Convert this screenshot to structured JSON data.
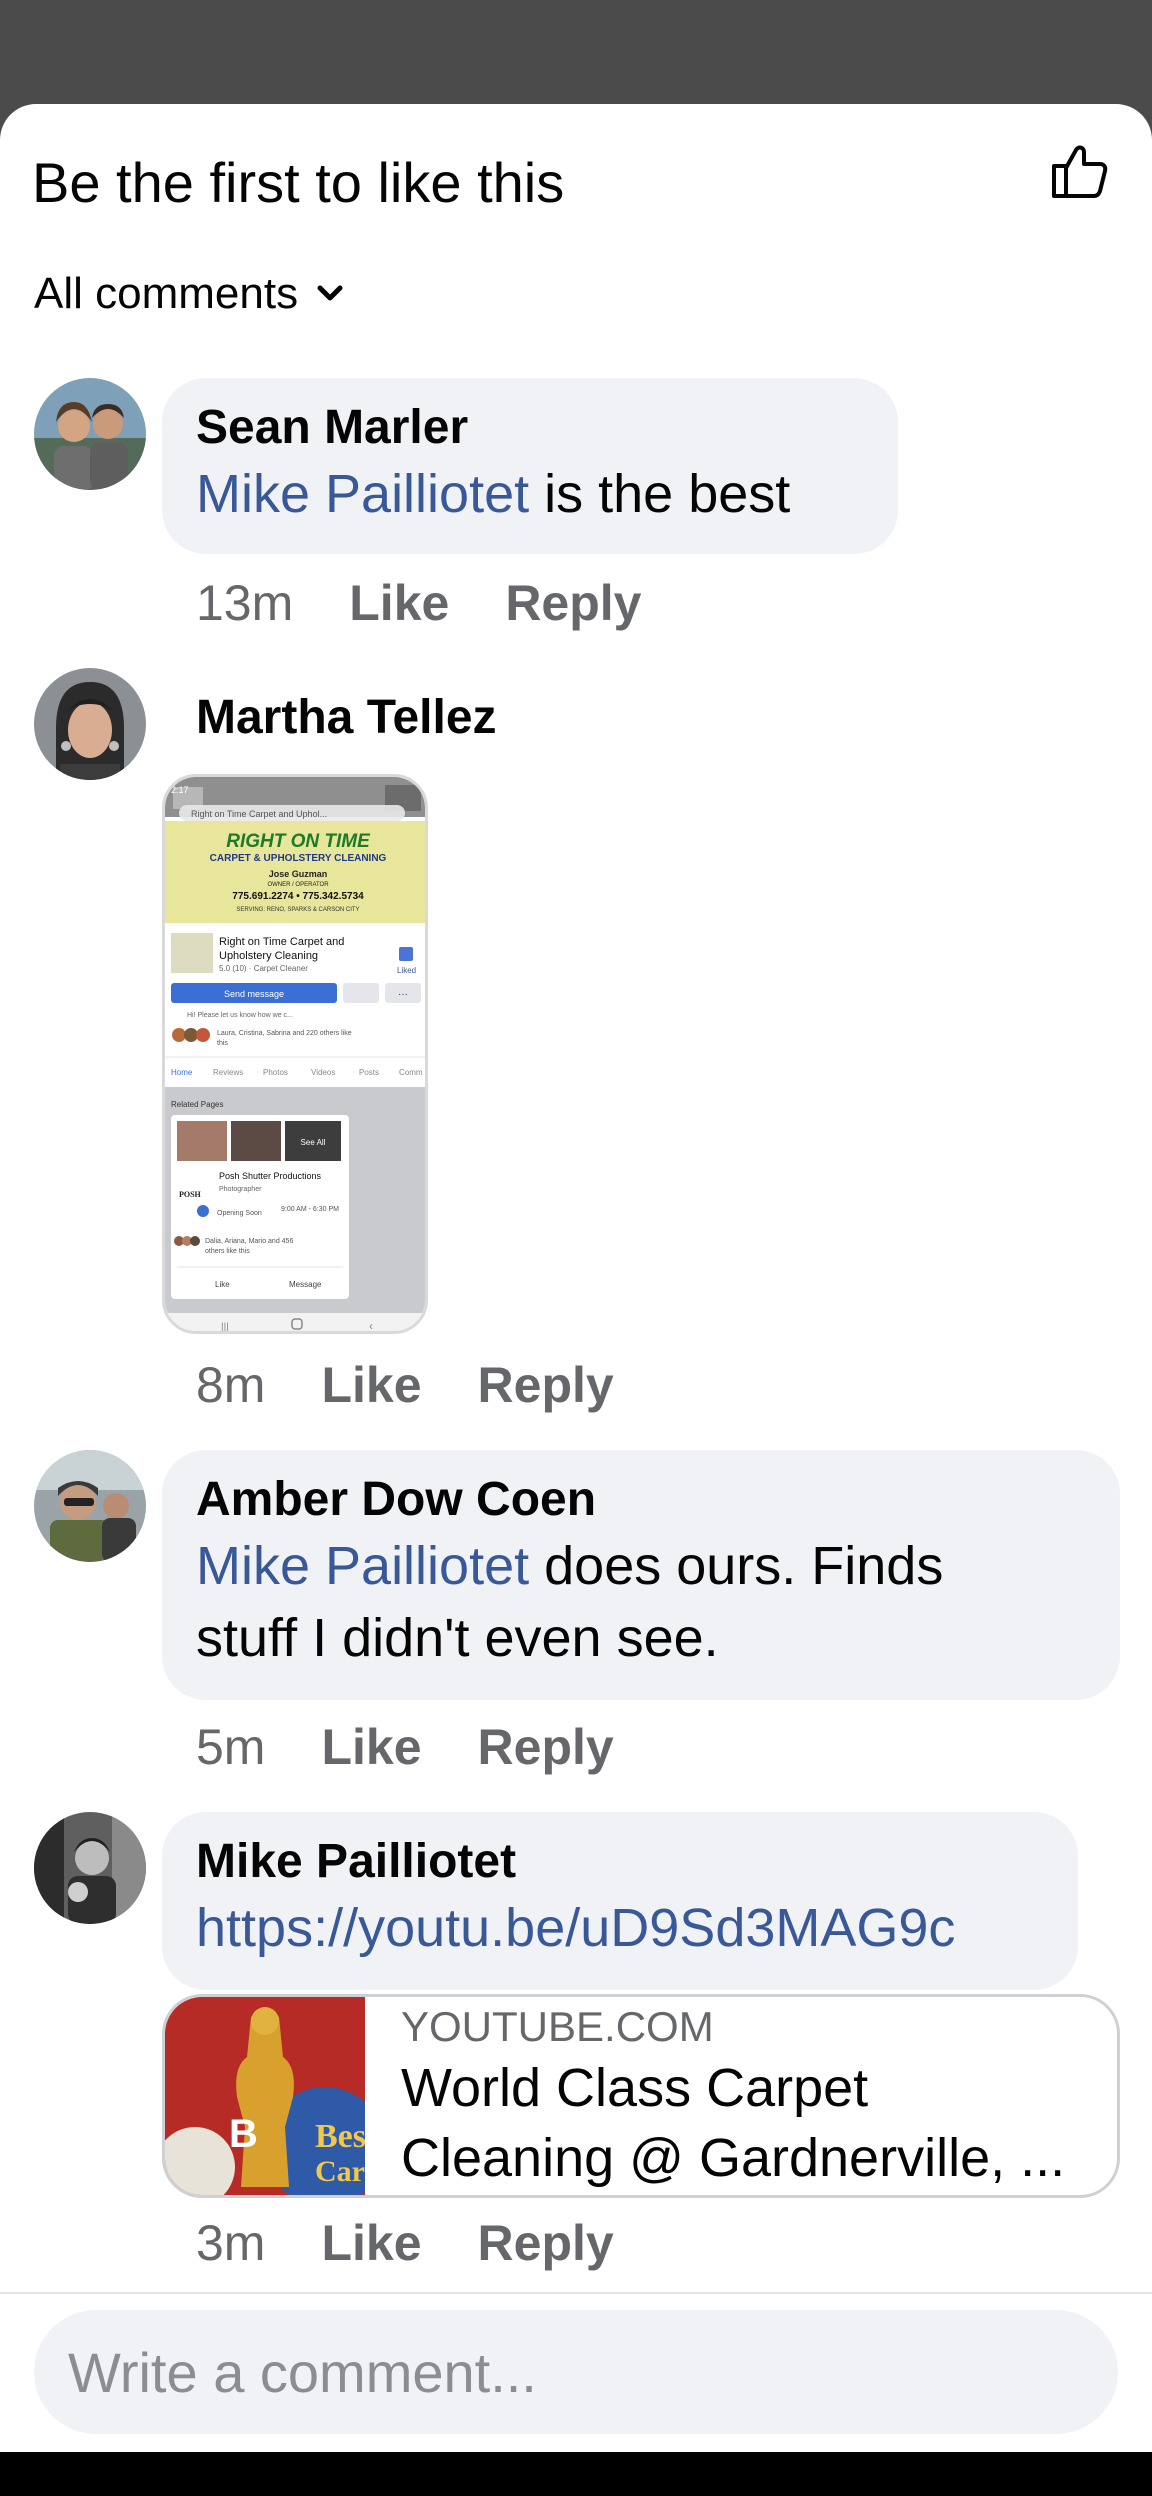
{
  "header": {
    "title": "Be the first to like this",
    "like_icon": "thumbs-up-icon"
  },
  "filter": {
    "label": "All comments",
    "icon": "chevron-down-icon"
  },
  "comments": [
    {
      "name": "Sean Marler",
      "mention": "Mike Pailliotet",
      "text": " is the best",
      "time": "13m",
      "like": "Like",
      "reply": "Reply"
    },
    {
      "name": "Martha Tellez",
      "attachment": {
        "status_time": "2:17",
        "search_text": "Right on Time Carpet and Uphol...",
        "banner_title": "RIGHT ON TIME",
        "banner_sub": "CARPET & UPHOLSTERY CLEANING",
        "owner": "Jose Guzman",
        "owner_role": "OWNER / OPERATOR",
        "phones": "775.691.2274 • 775.342.5734",
        "serving": "SERVING: RENO, SPARKS & CARSON CITY",
        "page_name": "Right on Time Carpet and Upholstery Cleaning",
        "rating": "5.0 (10)",
        "category": "Carpet Cleaner",
        "liked": "Liked",
        "send_message": "Send message",
        "prompt": "Hi! Please let us know how we c...",
        "likers": "Laura, Cristina, Sabrina and 220 others like this",
        "tabs": [
          "Home",
          "Reviews",
          "Photos",
          "Videos",
          "Posts",
          "Comm"
        ],
        "related": "Related Pages",
        "see_all": "See All",
        "related_name": "Posh Shutter Productions",
        "related_cat": "Photographer",
        "opening": "Opening Soon",
        "hours": "9:00 AM - 6:30 PM",
        "related_likers": "Dalia, Ariana, Mario and 456 others like this",
        "like_btn": "Like",
        "message_btn": "Message"
      },
      "time": "8m",
      "like": "Like",
      "reply": "Reply"
    },
    {
      "name": "Amber Dow Coen",
      "mention": "Mike Pailliotet",
      "text_line1": " does ours. Finds",
      "text_line2": "stuff I didn't even see.",
      "time": "5m",
      "like": "Like",
      "reply": "Reply"
    },
    {
      "name": "Mike Pailliotet",
      "link": "https://youtu.be/uD9Sd3MAG9c",
      "preview": {
        "domain": "YOUTUBE.COM",
        "title_line1": "World Class Carpet",
        "title_line2": "Cleaning @ Gardnerville, ..."
      },
      "time": "3m",
      "like": "Like",
      "reply": "Reply"
    }
  ],
  "composer": {
    "placeholder": "Write a comment..."
  }
}
